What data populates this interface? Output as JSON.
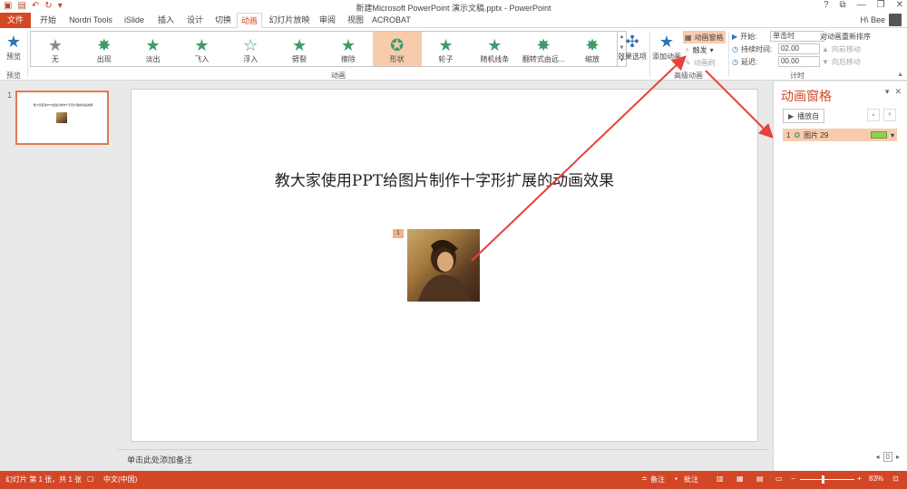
{
  "window": {
    "title": "新建Microsoft PowerPoint 演示文稿.pptx - PowerPoint",
    "controls": [
      "?",
      "⧉",
      "—",
      "❐",
      "✕"
    ]
  },
  "tabs": [
    "文件",
    "开始",
    "Nordri Tools",
    "iSlide",
    "插入",
    "设计",
    "切换",
    "动画",
    "幻灯片放映",
    "审阅",
    "视图",
    "ACROBAT"
  ],
  "active_tab": "动画",
  "user": {
    "name": "H\\ Bee"
  },
  "ribbon": {
    "preview": {
      "label": "预览",
      "group": "预览"
    },
    "effects": [
      "无",
      "出现",
      "淡出",
      "飞入",
      "浮入",
      "劈裂",
      "擦除",
      "形状",
      "轮子",
      "随机线条",
      "翻转式由远...",
      "缩放"
    ],
    "selected_effect": "形状",
    "animation_group": "动画",
    "effect_options": "效果选项",
    "add_animation": "添加动画",
    "animation_pane_btn": "动画窗格",
    "trigger": "触发",
    "animation_painter": "动画刷",
    "advanced_group": "高级动画",
    "timing": {
      "start_label": "开始:",
      "start_value": "单击时",
      "duration_label": "持续时间:",
      "duration_value": "02.00",
      "delay_label": "延迟:",
      "delay_value": "00.00",
      "reorder_label": "对动画重新排序",
      "move_earlier": "向前移动",
      "move_later": "向后移动",
      "group": "计时"
    }
  },
  "slide": {
    "number": "1",
    "title": "教大家使用PPT给图片制作十字形扩展的动画效果",
    "badge": "1",
    "thumb_title": "教大家使用PPT给图片制作十字形扩展的动画效果"
  },
  "notes": {
    "placeholder": "单击此处添加备注"
  },
  "anim_pane": {
    "title": "动画窗格",
    "play_button": "播放自",
    "item_number": "1",
    "item_label": "图片 29"
  },
  "status": {
    "slide_info": "幻灯片 第 1 张，共 1 张",
    "language": "中文(中国)",
    "notes_btn": "备注",
    "comments_btn": "批注",
    "zoom": "83%"
  },
  "colors": {
    "accent": "#d24726",
    "selected": "#f8cbad",
    "arrow": "#e8403a",
    "star": "#3e9c6a"
  }
}
